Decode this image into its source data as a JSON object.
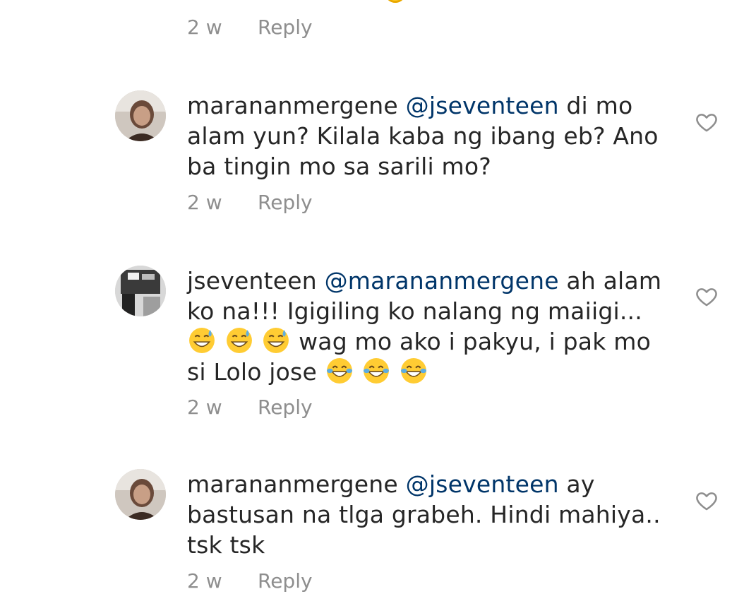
{
  "comments": [
    {
      "username": "",
      "mention": "",
      "text": "",
      "time": "2 w",
      "reply_label": "Reply"
    },
    {
      "username": "marananmergene",
      "mention": "@jseventeen",
      "text": "di mo alam yun? Kilala kaba ng ibang eb? Ano ba tingin mo sa sarili mo?",
      "time": "2 w",
      "reply_label": "Reply",
      "like_icon": "heart-outline-icon"
    },
    {
      "username": "jseventeen",
      "mention": "@marananmergene",
      "text_part1": "ah alam ko na!!! Igigiling ko nalang ng maiigi...",
      "text_part2": "wag mo ako i pakyu, i pak mo si Lolo jose",
      "emojis_1": [
        "grinning-sweat-emoji",
        "grinning-sweat-emoji",
        "grinning-sweat-emoji"
      ],
      "emojis_2": [
        "tears-of-joy-emoji",
        "tears-of-joy-emoji",
        "tears-of-joy-emoji"
      ],
      "time": "2 w",
      "reply_label": "Reply",
      "like_icon": "heart-outline-icon"
    },
    {
      "username": "marananmergene",
      "mention": "@jseventeen",
      "text": "ay bastusan na tlga grabeh. Hindi mahiya.. tsk tsk",
      "time": "2 w",
      "reply_label": "Reply",
      "like_icon": "heart-outline-icon"
    }
  ],
  "colors": {
    "text": "#262626",
    "mention": "#003569",
    "meta": "#8e8e8e"
  }
}
